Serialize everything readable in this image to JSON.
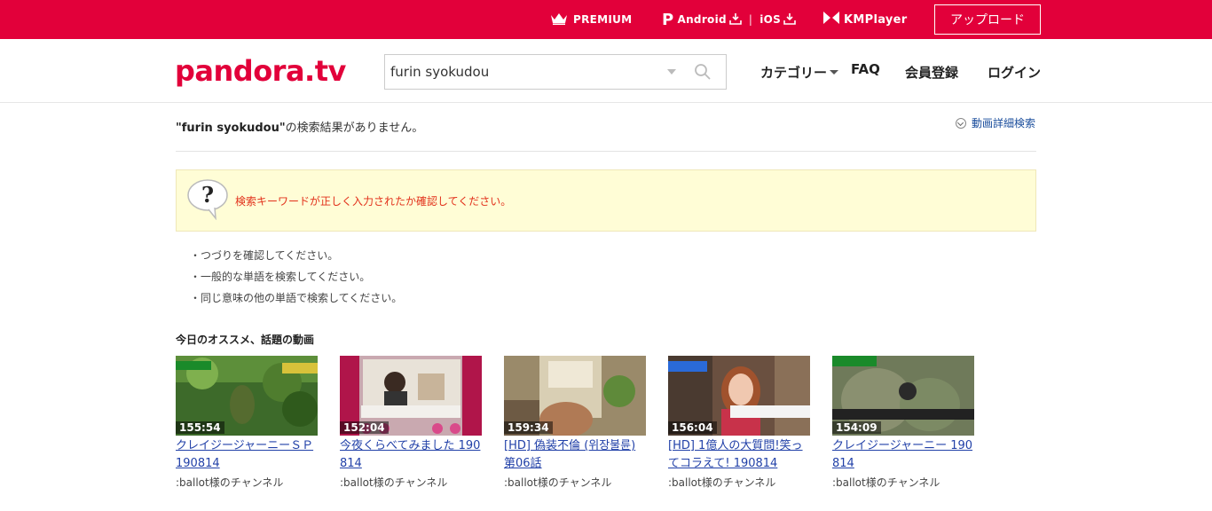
{
  "topbar": {
    "premium": "PREMIUM",
    "android": "Android",
    "ios": "iOS",
    "kmplayer": "KMPlayer",
    "upload": "アップロード"
  },
  "header": {
    "logo": "pandora.tv",
    "search_value": "furin syokudou",
    "nav_category": "カテゴリー",
    "nav_faq": "FAQ",
    "nav_register": "会員登録",
    "nav_login": "ログイン"
  },
  "result": {
    "query_quoted": "\"furin syokudou\"",
    "no_results_suffix": "の検索結果がありません。",
    "advanced_search": "動画詳細検索"
  },
  "notice": {
    "message": "検索キーワードが正しく入力されたか確認してください。"
  },
  "tips": [
    "・つづりを確認してください。",
    "・一般的な単語を検索してください。",
    "・同じ意味の他の単語で検索してください。"
  ],
  "recommend": {
    "title": "今日のオススメ、話題の動画",
    "videos": [
      {
        "duration": "155:54",
        "title": "クレイジージャーニーＳＰ 190814",
        "channel": ":ballot様のチャンネル"
      },
      {
        "duration": "152:04",
        "title": "今夜くらべてみました 190814",
        "channel": ":ballot様のチャンネル"
      },
      {
        "duration": "159:34",
        "title": "[HD] 偽装不倫 (위장불륜) 第06話",
        "channel": ":ballot様のチャンネル"
      },
      {
        "duration": "156:04",
        "title": "[HD] 1億人の大質問!笑ってコラえて! 190814",
        "channel": ":ballot様のチャンネル"
      },
      {
        "duration": "154:09",
        "title": "クレイジージャーニー 190814",
        "channel": ":ballot様のチャンネル"
      }
    ]
  },
  "colors": {
    "brand": "#e2003a",
    "link": "#2241a8",
    "notice_bg": "#fffdd6",
    "notice_text": "#e2301a"
  }
}
